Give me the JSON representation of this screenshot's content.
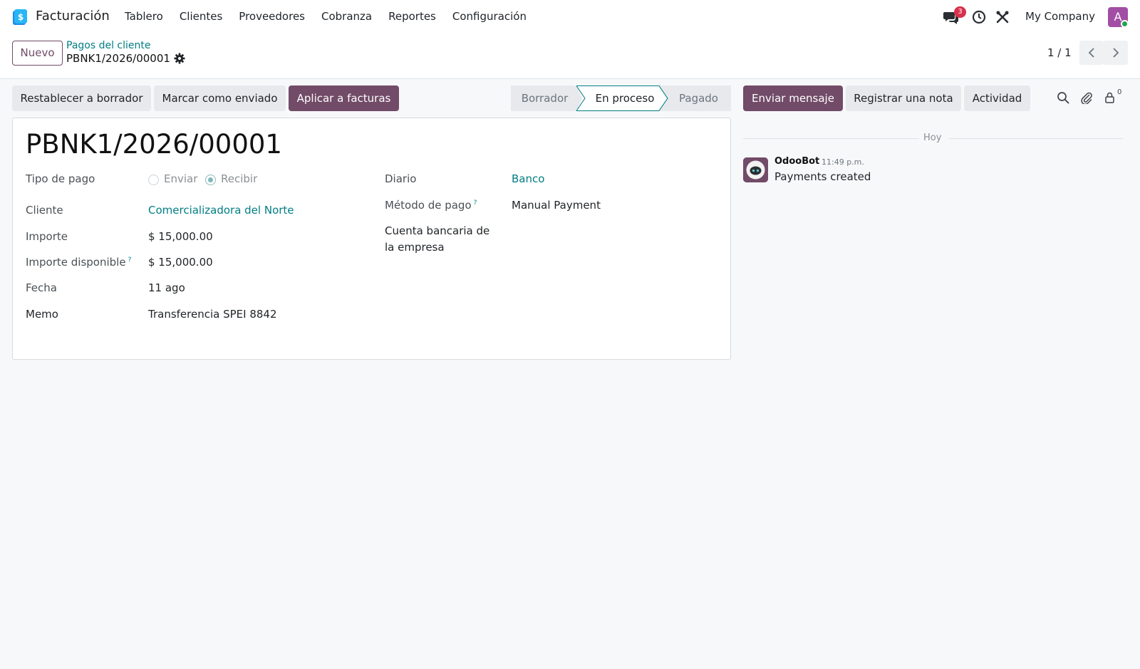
{
  "app": {
    "name": "Facturación",
    "menu": [
      "Tablero",
      "Clientes",
      "Proveedores",
      "Cobranza",
      "Reportes",
      "Configuración"
    ],
    "chat_badge": "3",
    "company": "My Company",
    "avatar_initial": "A"
  },
  "control": {
    "new_button": "Nuevo",
    "breadcrumb_parent": "Pagos del cliente",
    "breadcrumb_current": "PBNK1/2026/00001",
    "pager_value": "1 / 1"
  },
  "actions": {
    "reset": "Restablecer a borrador",
    "mark_sent": "Marcar como enviado",
    "apply_invoices": "Aplicar a facturas"
  },
  "status": {
    "stages": [
      "Borrador",
      "En proceso",
      "Pagado"
    ],
    "active": "En proceso"
  },
  "form": {
    "title": "PBNK1/2026/00001",
    "payment_type_label": "Tipo de pago",
    "payment_type_options": [
      "Enviar",
      "Recibir"
    ],
    "payment_type_selected": "Recibir",
    "customer_label": "Cliente",
    "customer_value": "Comercializadora del Norte",
    "amount_label": "Importe",
    "amount_value": "$ 15,000.00",
    "available_label": "Importe disponible",
    "available_value": "$ 15,000.00",
    "date_label": "Fecha",
    "date_value": "11 ago",
    "memo_label": "Memo",
    "memo_value": "Transferencia SPEI 8842",
    "journal_label": "Diario",
    "journal_value": "Banco",
    "method_label": "Método de pago",
    "method_value": "Manual Payment",
    "bank_label_line1": "Cuenta bancaria de",
    "bank_label_line2": "la empresa",
    "help_mark": "?"
  },
  "chatter": {
    "send_message": "Enviar mensaje",
    "log_note": "Registrar una nota",
    "activity": "Actividad",
    "followers_count": "0",
    "date_separator": "Hoy",
    "messages": [
      {
        "author": "OdooBot",
        "time": "11:49 p.m.",
        "body": "Payments created"
      }
    ]
  },
  "colors": {
    "brand": "#714b67",
    "link": "#017e84",
    "badge": "#d9304b"
  }
}
